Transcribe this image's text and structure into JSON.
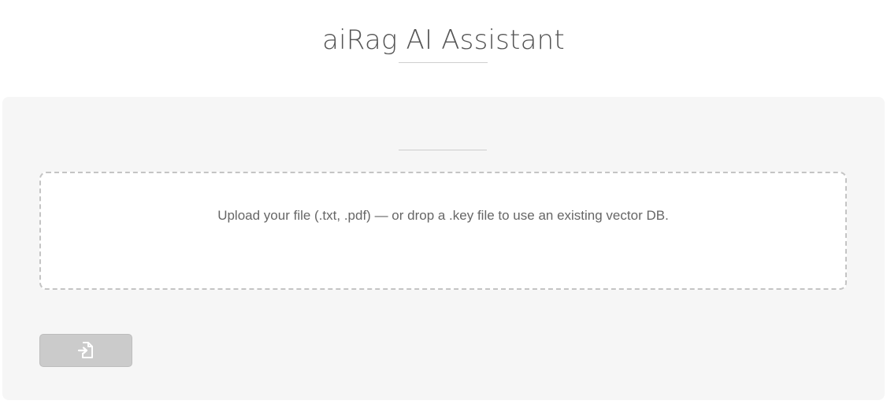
{
  "header": {
    "title": "aiRag AI Assistant"
  },
  "upload": {
    "dropzone_text": "Upload your file (.txt, .pdf) — or drop a .key file to use an existing vector DB."
  },
  "actions": {
    "submit_icon": "file-import-icon",
    "submit_disabled": true
  },
  "colors": {
    "panel_background": "#f6f6f6",
    "dropzone_border": "#c4c4c4",
    "button_disabled": "#cbcbcb",
    "text": "#555555"
  }
}
